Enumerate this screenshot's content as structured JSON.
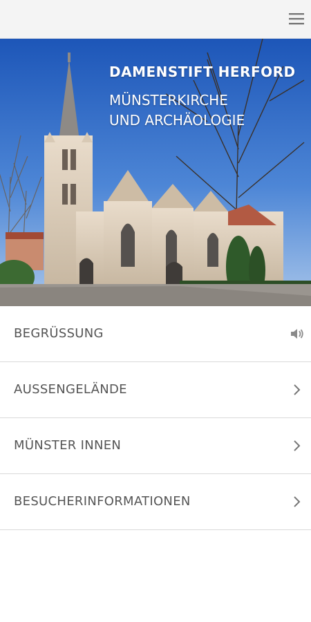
{
  "header": {
    "menu_icon": "hamburger-menu-icon"
  },
  "hero": {
    "title": "DAMENSTIFT HERFORD",
    "subtitle_line1": "MÜNSTERKIRCHE",
    "subtitle_line2": "UND ARCHÄOLOGIE",
    "image": "church-photo"
  },
  "menu": {
    "items": [
      {
        "label": "BEGRÜSSUNG",
        "icon": "speaker-icon"
      },
      {
        "label": "AUSSENGELÄNDE",
        "icon": "chevron-right-icon"
      },
      {
        "label": "MÜNSTER INNEN",
        "icon": "chevron-right-icon"
      },
      {
        "label": "BESUCHERINFORMATIONEN",
        "icon": "chevron-right-icon"
      }
    ]
  },
  "colors": {
    "topbar_bg": "#f4f4f4",
    "text": "#555555",
    "divider": "#d9d9d9",
    "icon": "#777777"
  }
}
